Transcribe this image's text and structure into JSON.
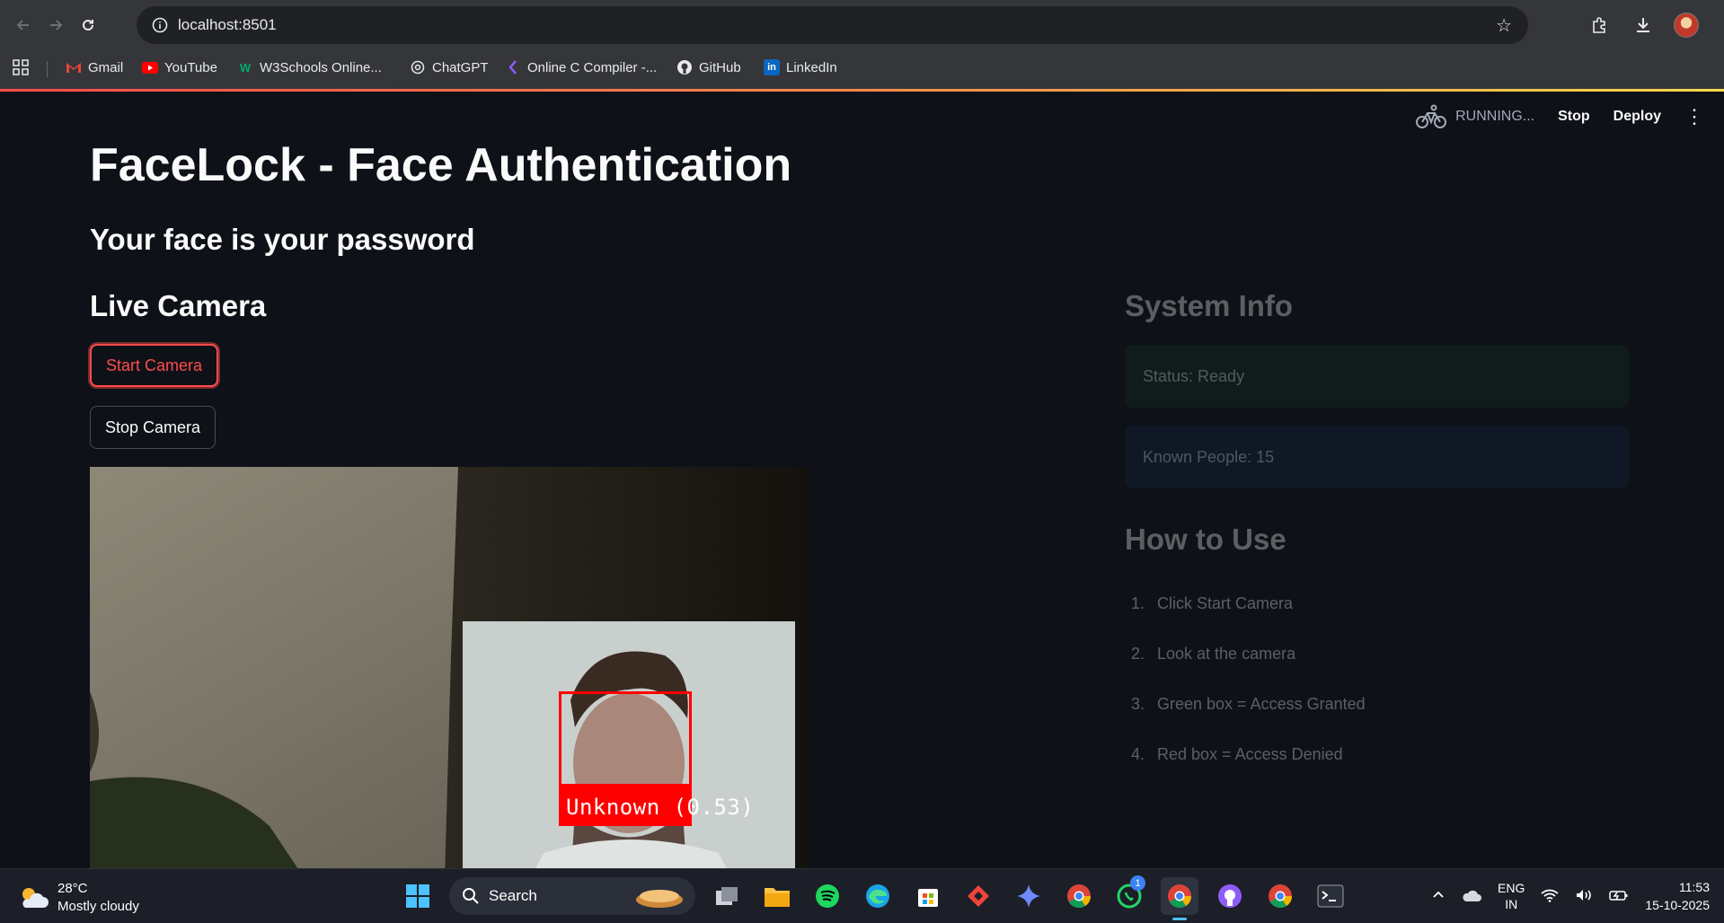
{
  "browser": {
    "url": "localhost:8501",
    "bookmarks": [
      {
        "label": "Gmail",
        "icon": "gmail-icon"
      },
      {
        "label": "YouTube",
        "icon": "youtube-icon"
      },
      {
        "label": "W3Schools Online...",
        "icon": "w3schools-icon"
      },
      {
        "label": "ChatGPT",
        "icon": "chatgpt-icon"
      },
      {
        "label": "Online C Compiler -...",
        "icon": "compiler-icon"
      },
      {
        "label": "GitHub",
        "icon": "github-icon"
      },
      {
        "label": "LinkedIn",
        "icon": "linkedin-icon"
      }
    ]
  },
  "st_header": {
    "running": "RUNNING...",
    "stop": "Stop",
    "deploy": "Deploy"
  },
  "main": {
    "title": "FaceLock - Face Authentication",
    "subtitle": "Your face is your password",
    "live_camera_heading": "Live Camera",
    "start_camera": "Start Camera",
    "stop_camera": "Stop Camera",
    "detection_label": "Unknown (0.53)"
  },
  "sidebar": {
    "system_info_heading": "System Info",
    "status": "Status: Ready",
    "known_people": "Known People: 15",
    "how_to_use_heading": "How to Use",
    "steps": [
      {
        "num": "1.",
        "text": "Click Start Camera"
      },
      {
        "num": "2.",
        "text": "Look at the camera"
      },
      {
        "num": "3.",
        "text": "Green box = Access Granted"
      },
      {
        "num": "4.",
        "text": "Red box = Access Denied"
      }
    ]
  },
  "taskbar": {
    "temperature": "28°C",
    "weather": "Mostly cloudy",
    "search": "Search",
    "whatsapp_badge": "1",
    "lang_top": "ENG",
    "lang_bottom": "IN",
    "time": "11:53",
    "date": "15-10-2025"
  },
  "colors": {
    "accent": "#ff4b4b",
    "background": "#0e1117",
    "detection_box": "#ff0000"
  }
}
